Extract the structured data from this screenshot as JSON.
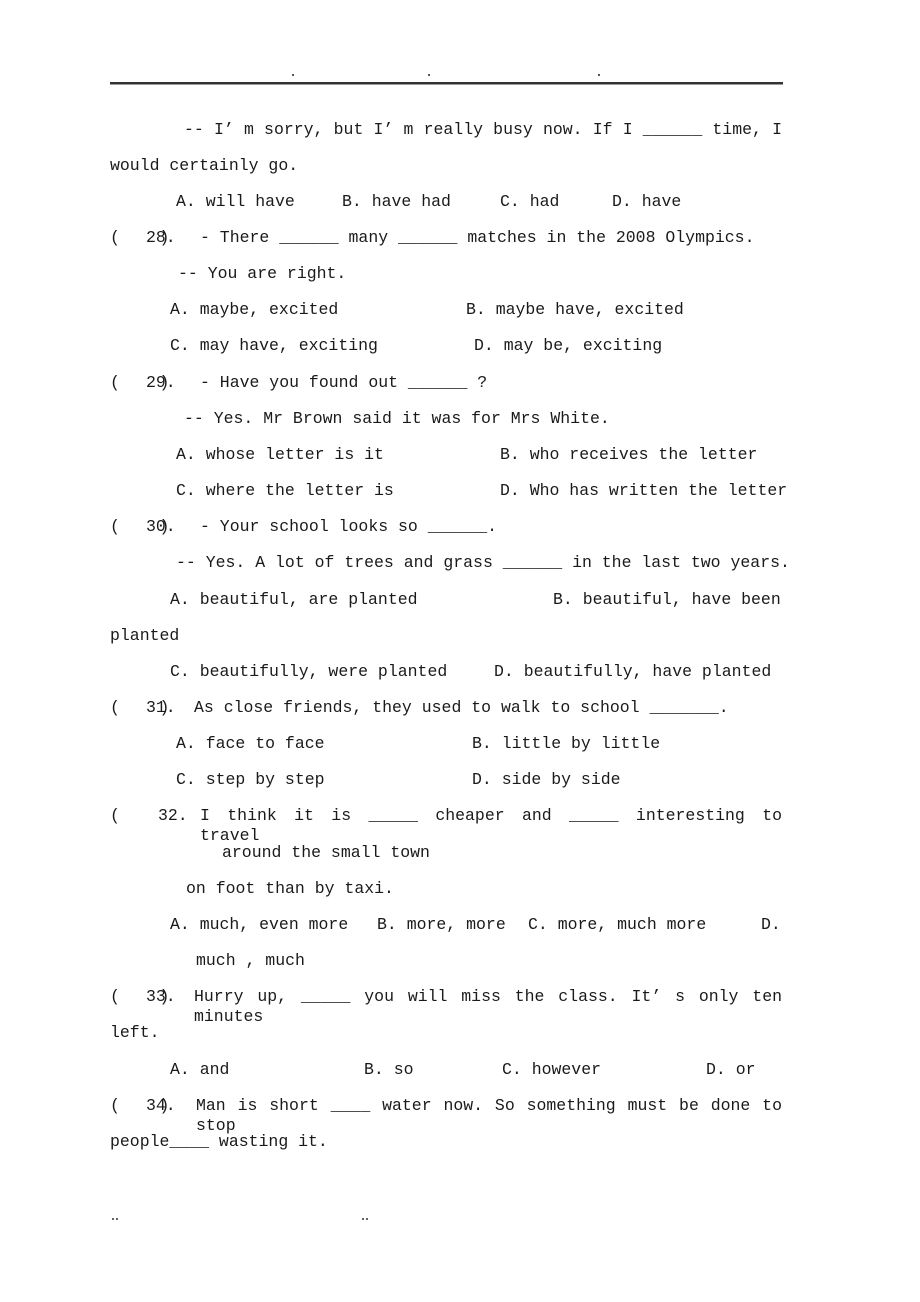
{
  "document": {
    "continuation_27": {
      "line1": "-- I’ m sorry, but I’ m really busy now. If I ______ time, I",
      "line2": "would certainly go.",
      "options": [
        "A. will have",
        "B. have had",
        "C. had",
        "D. have"
      ]
    },
    "questions": [
      {
        "number": "28.",
        "paren": "(    )",
        "prompt": "- There ______ many ______ matches in the 2008 Olympics.",
        "reply": "-- You are right.",
        "options": [
          "A. maybe, excited",
          "B. maybe have, excited",
          "C. may have, exciting",
          "D. may be, exciting"
        ]
      },
      {
        "number": "29.",
        "paren": "(    )",
        "prompt": "- Have you found out ______ ?",
        "reply": "-- Yes. Mr Brown said it was for Mrs White.",
        "options": [
          "A. whose letter is it",
          "B. who receives the letter",
          "C. where the letter is",
          "D. Who has written the letter"
        ]
      },
      {
        "number": "30.",
        "paren": "(    )",
        "prompt": "- Your school looks so ______.",
        "reply": "-- Yes. A lot of trees and grass ______ in the last two years.",
        "options": [
          "A. beautiful, are planted",
          "B. beautiful, have been",
          "planted",
          "C. beautifully, were planted",
          "D. beautifully, have planted"
        ]
      },
      {
        "number": "31.",
        "paren": "(    )",
        "prompt": "As close friends, they used to walk to school _______.",
        "options": [
          "A. face to face",
          "B. little by little",
          "C. step by step",
          "D. side by side"
        ]
      },
      {
        "number": "32.",
        "paren": "(",
        "prompt": "I think it is _____ cheaper and _____ interesting to travel",
        "prompt_cont1": "around the small town",
        "prompt_cont2": "on foot than by taxi.",
        "options": [
          "A. much, even more",
          "B. more, more",
          "C. more, much more",
          "D.",
          "much , much"
        ]
      },
      {
        "number": "33.",
        "paren": "(    )",
        "prompt": "Hurry up, _____ you will miss the class. It’ s only ten minutes",
        "prompt_cont1": "left.",
        "options": [
          "A. and",
          "B. so",
          "C. however",
          "D. or"
        ]
      },
      {
        "number": "34.",
        "paren": "(    )",
        "prompt": "Man is short ____ water now. So something must be done to stop",
        "prompt_cont1": "people____ wasting it."
      }
    ],
    "footer": {
      "left_mark": "..",
      "right_mark": ".."
    }
  }
}
